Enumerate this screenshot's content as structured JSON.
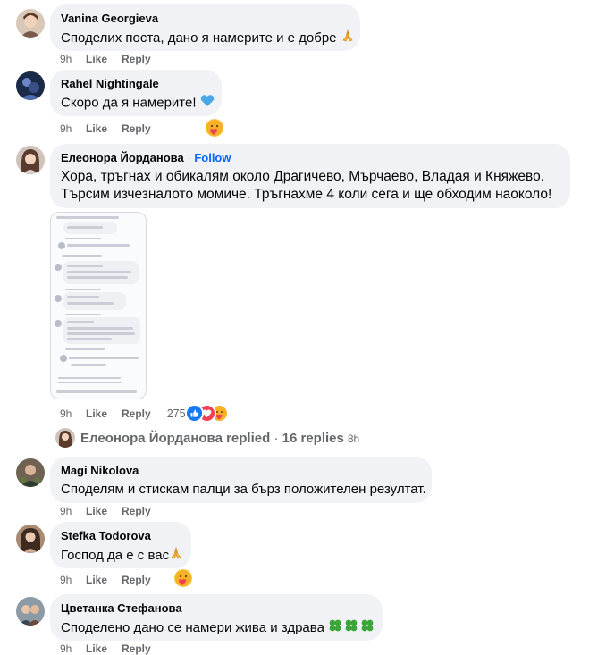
{
  "comments": [
    {
      "author": "Vanina Georgieva",
      "text": "Споделих поста, дано я намерите и е добре",
      "text_emoji": "pray-emoji",
      "time": "9h",
      "like": "Like",
      "reply": "Reply"
    },
    {
      "author": "Rahel Nightingale",
      "text": "Скоро да я намерите!",
      "text_emoji": "blue-heart-emoji",
      "time": "9h",
      "like": "Like",
      "reply": "Reply",
      "reaction": "care-reaction"
    },
    {
      "author": "Елеонора Йорданова",
      "separator": "·",
      "follow": "Follow",
      "text_line1": "Хора, тръгнах и обикалям около Драгичево, Мърчаево, Владая и Княжево.",
      "text_line2": "Търсим изчезналото момиче. Тръгнахме 4 коли сега и ще обходим наоколо!",
      "time": "9h",
      "like": "Like",
      "reply": "Reply",
      "reaction_count": "275",
      "reactions": [
        "like-reaction",
        "love-reaction",
        "care-reaction"
      ],
      "attachment": "screenshot-of-comments"
    },
    {
      "author": "Magi Nikolova",
      "text": "Споделям и стискам палци за бърз положителен резултат.",
      "time": "9h",
      "like": "Like",
      "reply": "Reply"
    },
    {
      "author": "Stefka Todorova",
      "text": "Господ да е с вас",
      "text_emoji": "pray-emoji",
      "time": "9h",
      "like": "Like",
      "reply": "Reply",
      "reaction": "care-reaction"
    },
    {
      "author": "Цветанка Стефанова",
      "text": "Споделено дано се намери жива и здрава",
      "text_emoji": "four-leaf-clover-emoji",
      "time": "9h",
      "like": "Like",
      "reply": "Reply"
    }
  ],
  "replies_summary": {
    "author": "Елеонора Йорданова",
    "label": "replied",
    "separator": "·",
    "count": "16 replies",
    "time": "8h"
  },
  "colors": {
    "bubble": "#f0f2f5",
    "secondary_text": "#65676b",
    "follow_link": "#0866ff",
    "like_reaction": "#1877f2",
    "love_reaction": "#f33e58",
    "care_reaction": "#f7b125"
  }
}
